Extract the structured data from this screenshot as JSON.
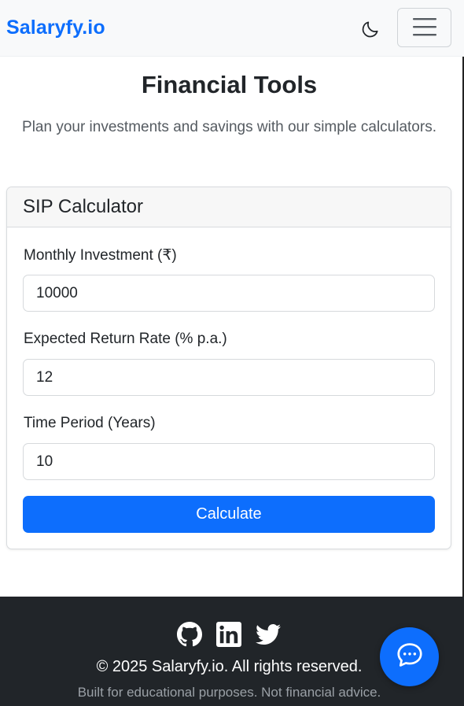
{
  "navbar": {
    "brand": "Salaryfy.io",
    "theme_icon": "moon-icon",
    "menu_icon": "hamburger-menu-icon"
  },
  "header": {
    "title": "Financial Tools",
    "subtitle": "Plan your investments and savings with our simple calculators."
  },
  "sip_calculator": {
    "title": "SIP Calculator",
    "fields": [
      {
        "label": "Monthly Investment (₹)",
        "value": "10000"
      },
      {
        "label": "Expected Return Rate (% p.a.)",
        "value": "12"
      },
      {
        "label": "Time Period (Years)",
        "value": "10"
      }
    ],
    "button_label": "Calculate"
  },
  "footer": {
    "icons": [
      "github-icon",
      "linkedin-icon",
      "twitter-icon"
    ],
    "copyright": "© 2025 Salaryfy.io. All rights reserved.",
    "disclaimer": "Built for educational purposes. Not financial advice."
  },
  "chat": {
    "icon": "chat-bubble-icon"
  },
  "colors": {
    "accent": "#0d6efd",
    "footer_bg": "#212529",
    "navbar_bg": "#f8f9fa"
  }
}
